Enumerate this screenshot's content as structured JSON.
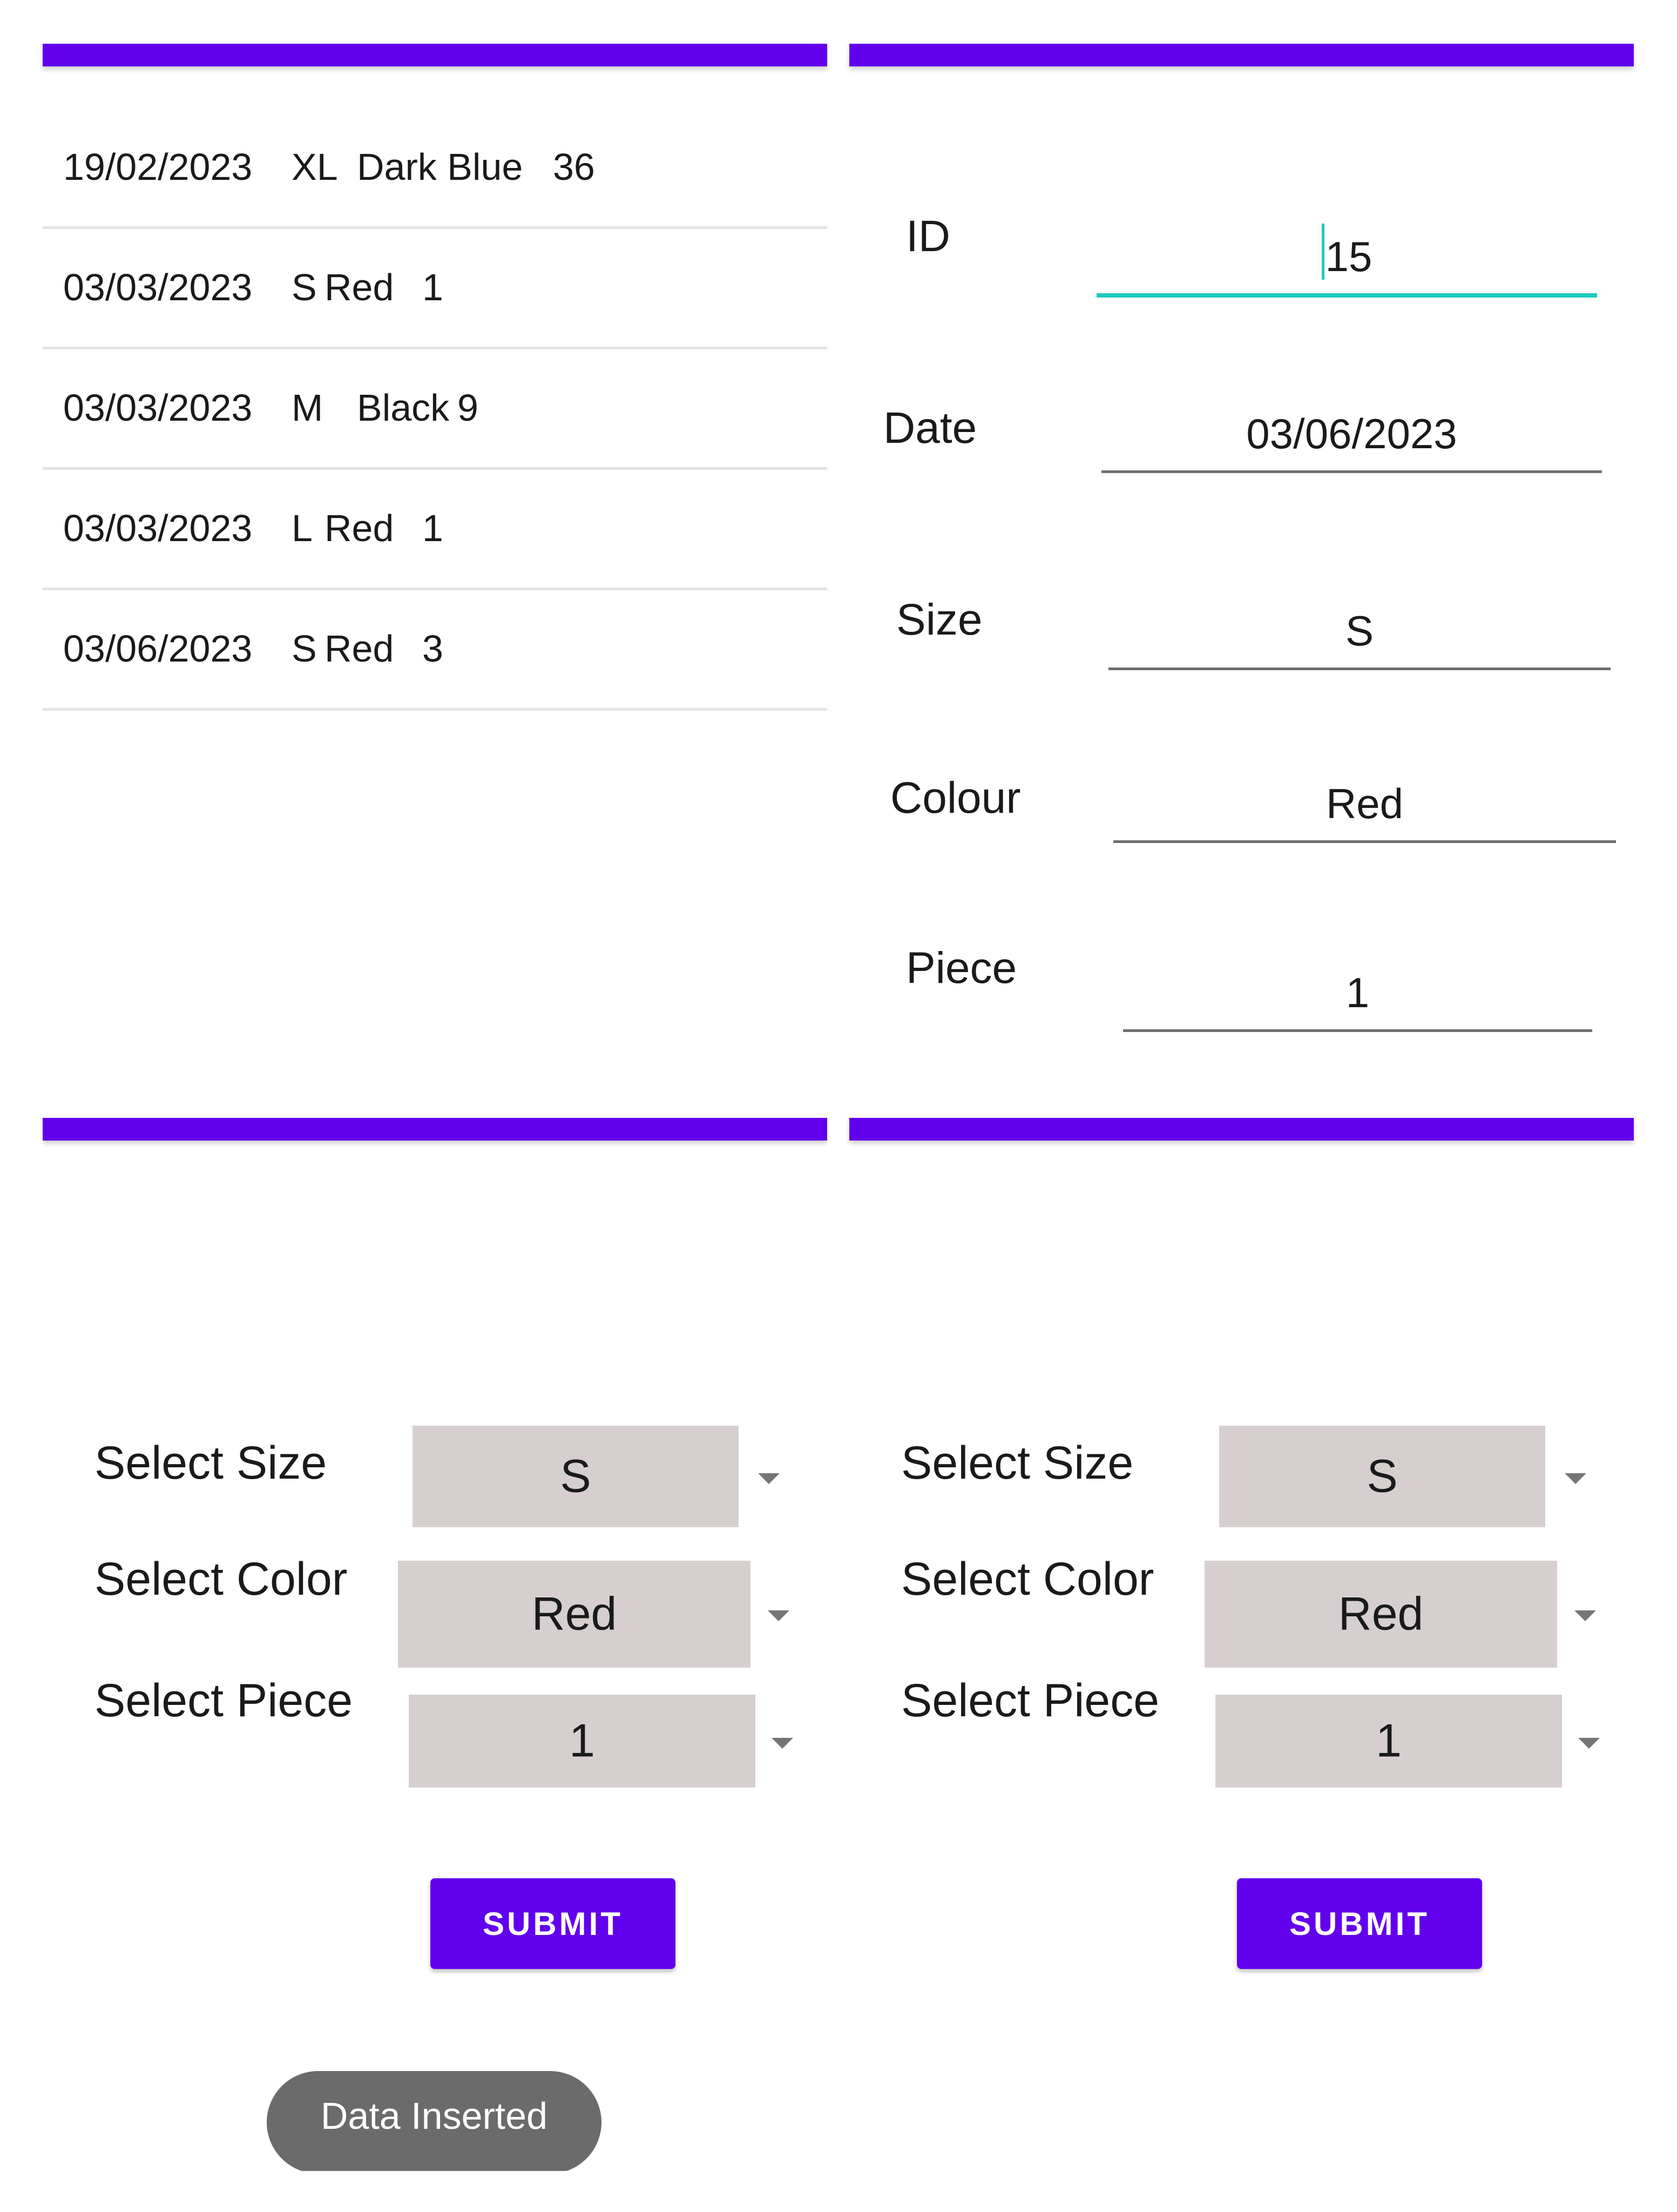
{
  "colors": {
    "primary": "#6200ee",
    "field_focus": "#1fc9bd",
    "spinner_bg": "#d7cfcf",
    "toast_bg": "#6b6b6b"
  },
  "records": [
    {
      "date": "19/02/2023",
      "size": "XL",
      "colour": "Dark Blue",
      "piece": "36"
    },
    {
      "date": "03/03/2023",
      "size": "S",
      "colour": "Red",
      "piece": "1"
    },
    {
      "date": "03/03/2023",
      "size": "M",
      "colour": "Black",
      "piece": "9"
    },
    {
      "date": "03/03/2023",
      "size": "L",
      "colour": "Red",
      "piece": "1"
    },
    {
      "date": "03/06/2023",
      "size": "S",
      "colour": "Red",
      "piece": "3"
    }
  ],
  "detail_form": {
    "id_label": "ID",
    "id_value": "15",
    "date_label": "Date",
    "date_value": "03/06/2023",
    "size_label": "Size",
    "size_value": "S",
    "colour_label": "Colour",
    "colour_value": "Red",
    "piece_label": "Piece",
    "piece_value": "1"
  },
  "select_form_a": {
    "size_label": "Select Size",
    "size_value": "S",
    "color_label": "Select Color",
    "color_value": "Red",
    "piece_label": "Select Piece",
    "piece_value": "1",
    "submit_label": "SUBMIT",
    "toast_text": "Data Inserted"
  },
  "select_form_b": {
    "size_label": "Select Size",
    "size_value": "S",
    "color_label": "Select Color",
    "color_value": "Red",
    "piece_label": "Select Piece",
    "piece_value": "1",
    "submit_label": "SUBMIT"
  }
}
